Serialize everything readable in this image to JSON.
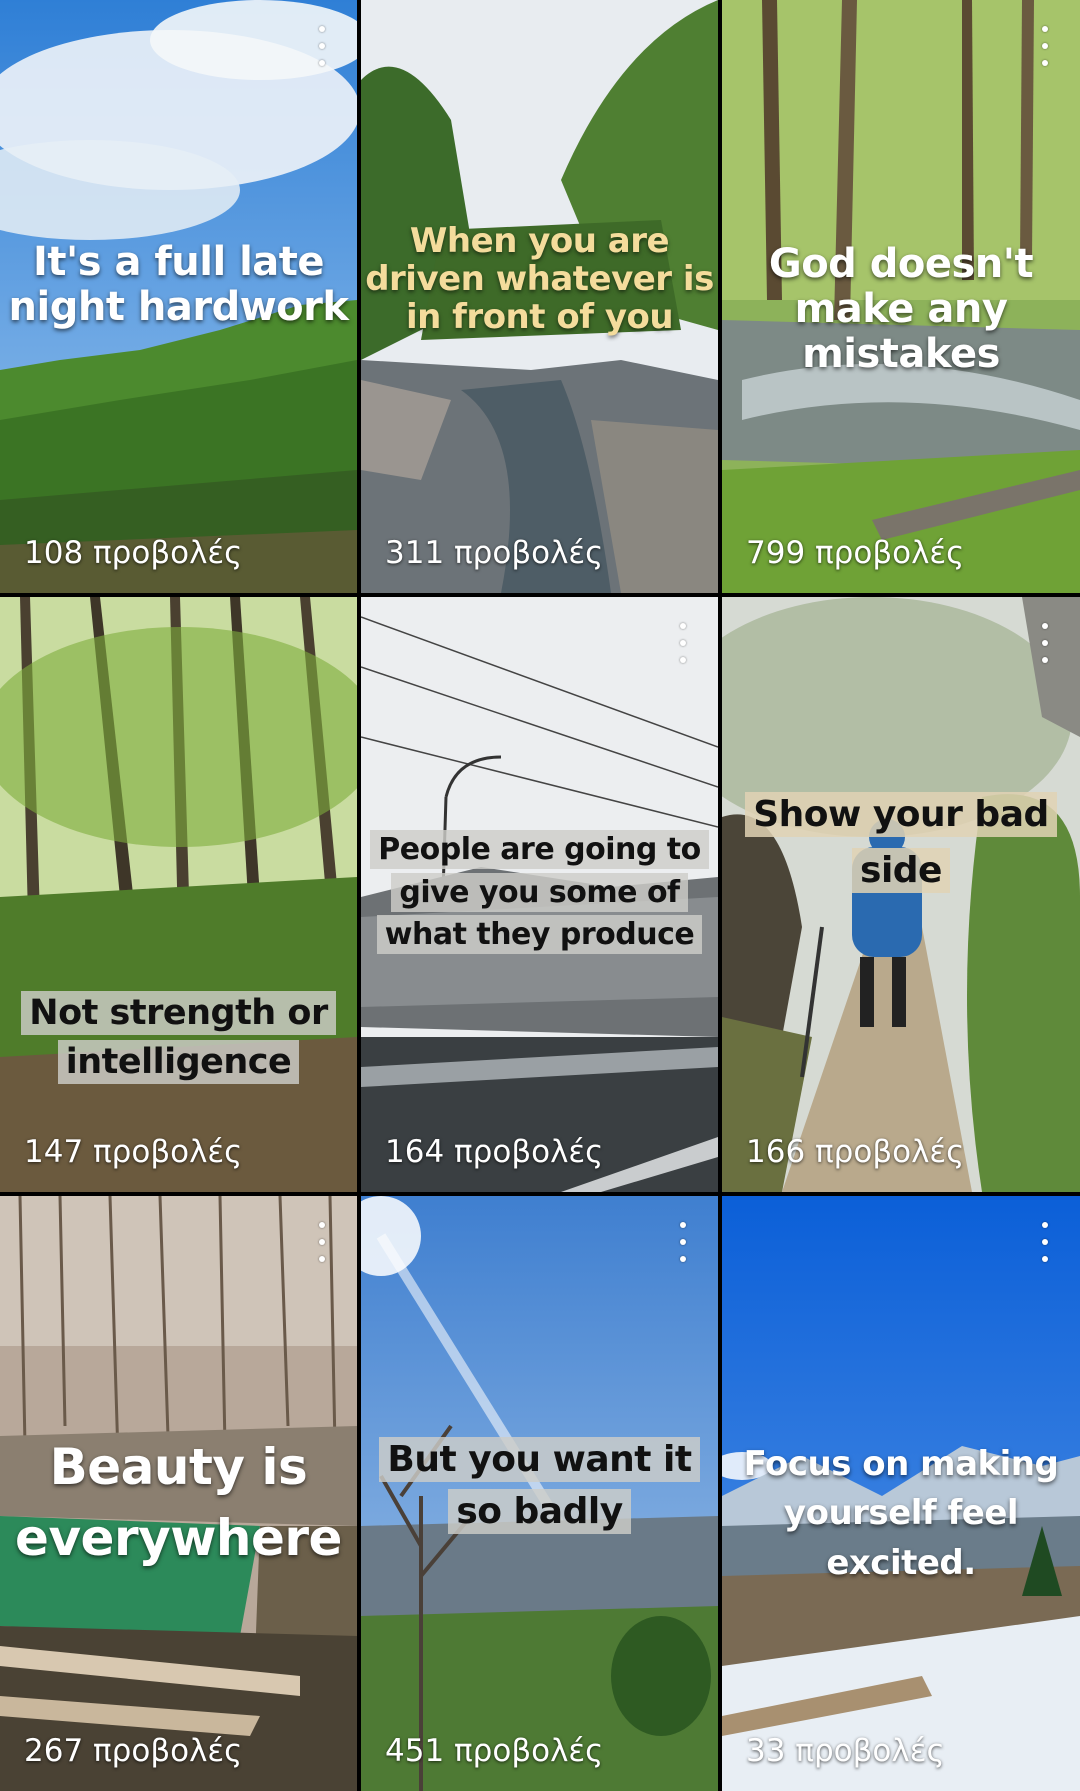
{
  "tiles": [
    {
      "caption": "It's a full late night hardwork",
      "views": "108 προβολές"
    },
    {
      "caption": "When you are driven whatever is in front of you",
      "views": "311 προβολές"
    },
    {
      "caption": "God doesn't make any mistakes",
      "views": "799 προβολές"
    },
    {
      "caption": "Not strength or intelligence",
      "views": "147 προβολές"
    },
    {
      "caption": "People are going to give you some of what they produce",
      "views": "164 προβολές"
    },
    {
      "caption": "Show your bad side",
      "views": "166 προβολές"
    },
    {
      "caption": "Beauty is everywhere",
      "views": "267 προβολές"
    },
    {
      "caption": "But you want it so badly",
      "views": "451 προβολές"
    },
    {
      "caption": "Focus on making yourself feel excited.",
      "views": "33 προβολές"
    }
  ],
  "icons": {
    "menu": "more-vert-icon"
  }
}
